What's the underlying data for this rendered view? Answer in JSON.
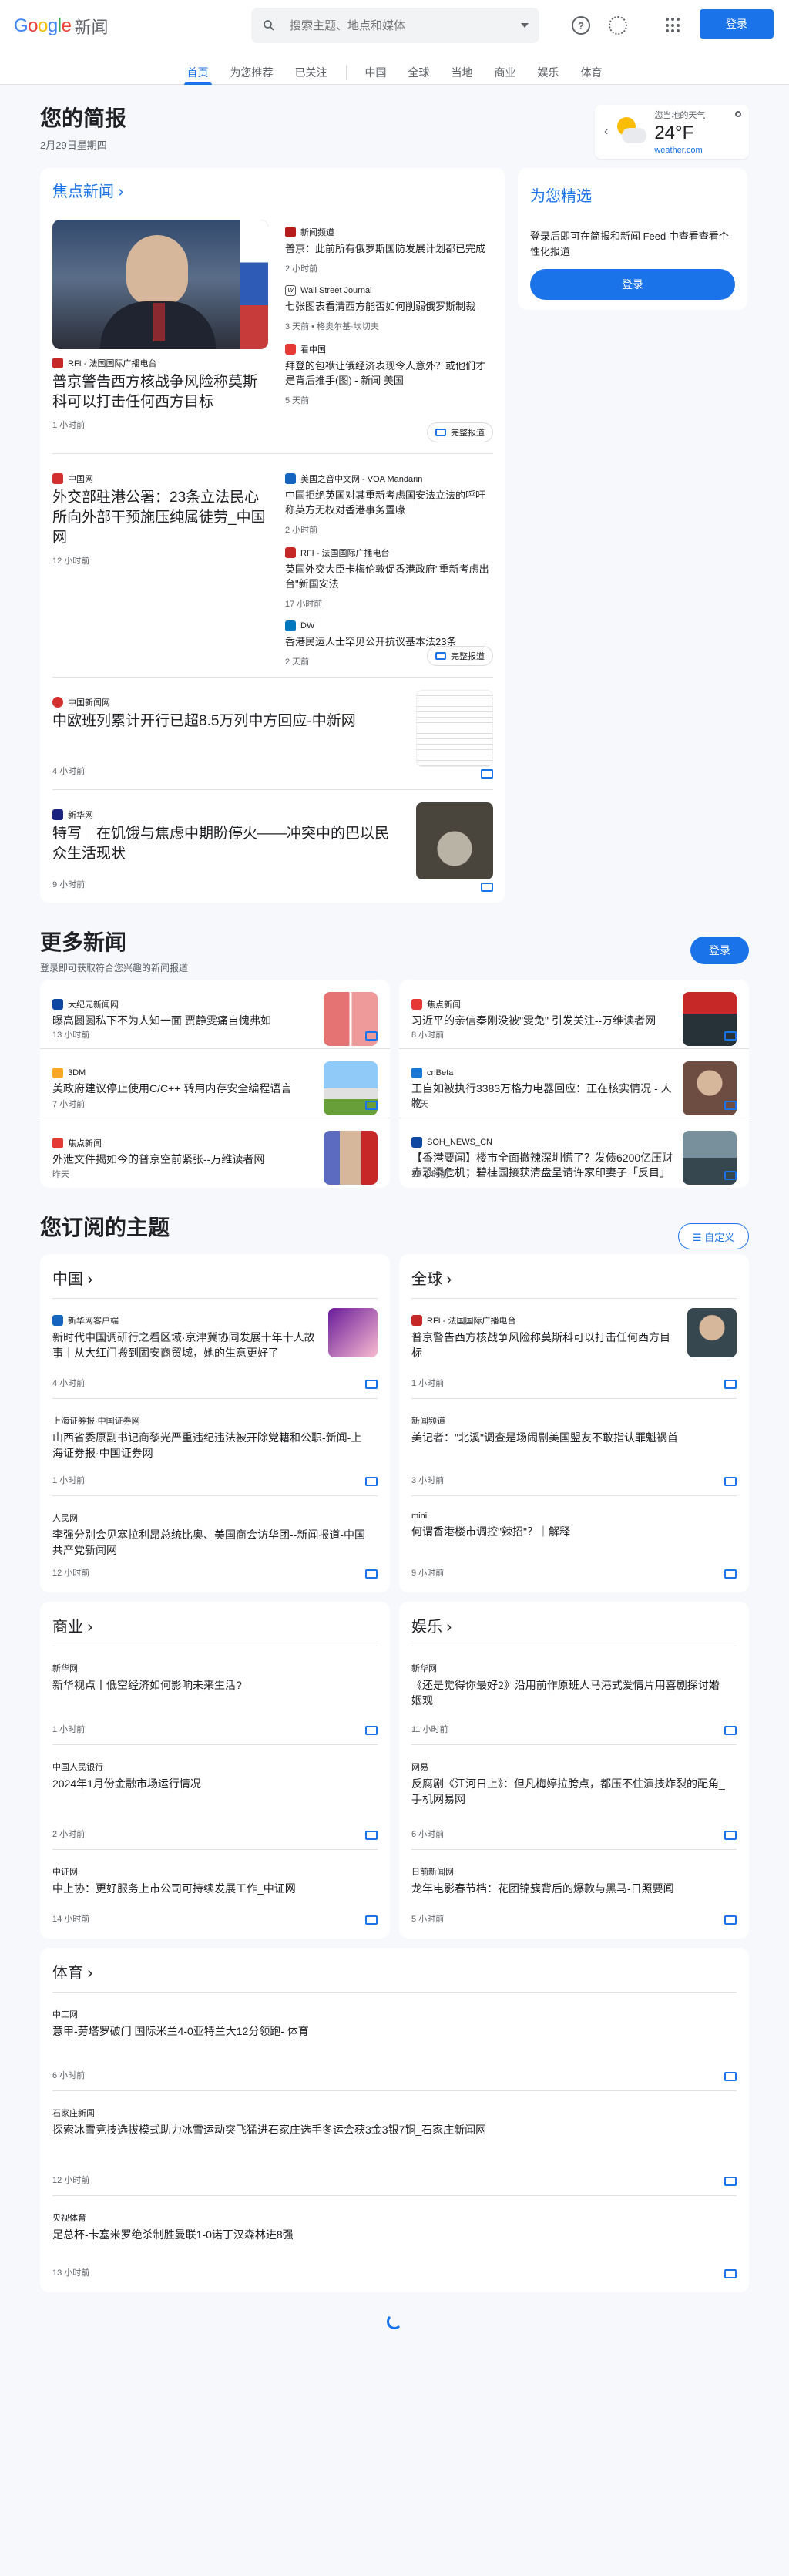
{
  "header": {
    "logo_word": "Google",
    "logo_product": "新闻",
    "search_placeholder": "搜索主题、地点和媒体",
    "login": "登录"
  },
  "nav": [
    "首页",
    "为您推荐",
    "已关注",
    "中国",
    "全球",
    "当地",
    "商业",
    "娱乐",
    "体育"
  ],
  "briefing": {
    "title": "您的简报",
    "date": "2月29日星期四",
    "weather": {
      "location": "您当地的天气",
      "temp": "24°F",
      "source": "weather.com"
    }
  },
  "top": {
    "section": "焦点新闻",
    "full_coverage": "完整报道",
    "clusters": [
      {
        "main": {
          "source": "RFI - 法国国际广播电台",
          "title": "普京警告西方核战争风险称莫斯科可以打击任何西方目标",
          "time": "1 小时前"
        },
        "subs": [
          {
            "source": "新闻频道",
            "title": "普京：此前所有俄罗斯国防发展计划都已完成",
            "time": "2 小时前"
          },
          {
            "source": "Wall Street Journal",
            "title": "七张图表看清西方能否如何削弱俄罗斯制裁",
            "time": "3 天前 • 格奥尔基·坎切夫"
          },
          {
            "source": "看中国",
            "title": "拜登的包袱让俄经济表现令人意外？或他们才是背后推手(图) - 新闻 美国",
            "time": "5 天前"
          }
        ]
      },
      {
        "main": {
          "source": "中国网",
          "title": "外交部驻港公署：23条立法民心所向外部干预施压纯属徒劳_中国网",
          "time": "12 小时前"
        },
        "subs": [
          {
            "source": "美国之音中文网 - VOA Mandarin",
            "title": "中国拒绝英国对其重新考虑国安法立法的呼吁 称英方无权对香港事务置喙",
            "time": "2 小时前"
          },
          {
            "source": "RFI - 法国国际广播电台",
            "title": "英国外交大臣卡梅伦敦促香港政府\"重新考虑出台\"新国安法",
            "time": "17 小时前"
          },
          {
            "source": "DW",
            "title": "香港民运人士罕见公开抗议基本法23条",
            "time": "2 天前"
          }
        ]
      }
    ],
    "singles": [
      {
        "source": "中国新闻网",
        "title": "中欧班列累计开行已超8.5万列中方回应-中新网",
        "time": "4 小时前"
      },
      {
        "source": "新华网",
        "title": "特写｜在饥饿与焦虑中期盼停火——冲突中的巴以民众生活现状",
        "time": "9 小时前"
      }
    ]
  },
  "for_you": {
    "title": "为您精选",
    "text": "登录后即可在简报和新闻 Feed 中查看查看个性化报道",
    "button": "登录"
  },
  "more": {
    "title": "更多新闻",
    "subtitle": "登录即可获取符合您兴趣的新闻报道",
    "button": "登录",
    "left": [
      {
        "source": "大纪元新闻网",
        "title": "曝高圆圆私下不为人知一面 贾静雯痛自愧弗如",
        "time": "13 小时前"
      },
      {
        "source": "3DM",
        "title": "美政府建议停止使用C/C++ 转用内存安全编程语言",
        "time": "7 小时前"
      },
      {
        "source": "焦点新闻",
        "title": "外泄文件揭如今的普京空前紧张--万维读者网",
        "time": "昨天"
      }
    ],
    "right": [
      {
        "source": "焦点新闻",
        "title": "习近平的亲信秦刚没被\"雯免\" 引发关注--万维读者网",
        "time": "8 小时前"
      },
      {
        "source": "cnBeta",
        "title": "王自如被执行3383万格力电器回应：正在核实情况 - 人物",
        "time": "昨天"
      },
      {
        "source": "SOH_NEWS_CN",
        "title": "【香港要闻】楼市全面撤辣深圳慌了？发债6200亿压财赤恐添危机；碧桂园接获清盘呈请许家印妻子「反目」",
        "time": "16 小时前"
      }
    ]
  },
  "topics": {
    "title": "您订阅的主题",
    "customize": "自定义",
    "china": {
      "title": "中国",
      "items": [
        {
          "source": "新华网客户端",
          "title": "新时代中国调研行之看区域·京津冀协同发展十年十人故事｜从大红门搬到固安商贸城，她的生意更好了",
          "time": "4 小时前"
        },
        {
          "source": "上海证券报·中国证券网",
          "title": "山西省委原副书记商黎光严重违纪违法被开除党籍和公职-新闻-上海证券报·中国证券网",
          "time": "1 小时前"
        },
        {
          "source": "人民网",
          "title": "李强分别会见塞拉利昂总统比奥、美国商会访华团--新闻报道-中国共产党新闻网",
          "time": "12 小时前"
        }
      ]
    },
    "world": {
      "title": "全球",
      "items": [
        {
          "source": "RFI - 法国国际广播电台",
          "title": "普京警告西方核战争风险称莫斯科可以打击任何西方目标",
          "time": "1 小时前"
        },
        {
          "source": "新闻频道",
          "title": "美记者：\"北溪\"调查是场闹剧美国盟友不敢指认罪魁祸首",
          "time": "3 小时前"
        },
        {
          "source": "mini",
          "title": "何谓香港楼市调控\"辣招\"？｜解释",
          "time": "9 小时前"
        }
      ]
    },
    "business": {
      "title": "商业",
      "items": [
        {
          "source": "新华网",
          "title": "新华视点丨低空经济如何影响未来生活?",
          "time": "1 小时前"
        },
        {
          "source": "中国人民银行",
          "title": "2024年1月份金融市场运行情况",
          "time": "2 小时前"
        },
        {
          "source": "中证网",
          "title": "中上协：更好服务上市公司可持续发展工作_中证网",
          "time": "14 小时前"
        }
      ]
    },
    "ent": {
      "title": "娱乐",
      "items": [
        {
          "source": "新华网",
          "title": "《还是觉得你最好2》沿用前作原班人马港式爱情片用喜剧探讨婚姻观",
          "time": "11 小时前"
        },
        {
          "source": "网易",
          "title": "反腐剧《江河日上》：但凡梅婷拉胯点，都压不住演技炸裂的配角_手机网易网",
          "time": "6 小时前"
        },
        {
          "source": "日前新闻网",
          "title": "龙年电影春节档：花团锦簇背后的爆款与黑马-日照要闻",
          "time": "5 小时前"
        }
      ]
    },
    "sports": {
      "title": "体育",
      "items": [
        {
          "source": "中工网",
          "title": "意甲-劳塔罗破门 国际米兰4-0亚特兰大12分领跑- 体育",
          "time": "6 小时前"
        },
        {
          "source": "石家庄新闻",
          "title": "探索冰雪竞技选拔模式助力冰雪运动突飞猛进石家庄选手冬运会获3金3银7铜_石家庄新闻网",
          "time": "12 小时前"
        },
        {
          "source": "央视体育",
          "title": "足总杯-卡塞米罗绝杀制胜曼联1-0诺丁汉森林进8强",
          "time": "13 小时前"
        }
      ]
    }
  },
  "colors": {
    "accent": "#1a73e8",
    "bg": "#f6f8fc"
  }
}
